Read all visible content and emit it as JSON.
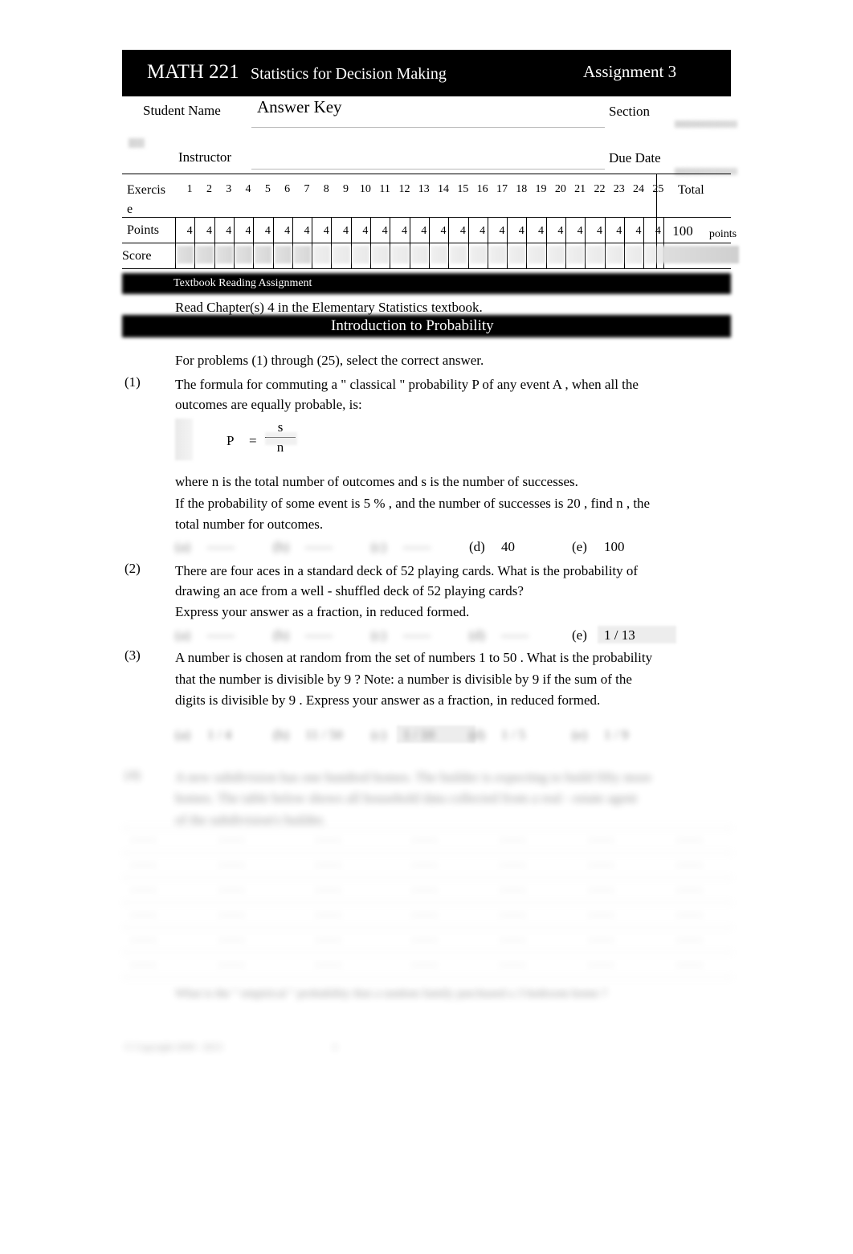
{
  "header": {
    "course": "MATH 221",
    "title": "Statistics for Decision Making",
    "assignment": "Assignment 3"
  },
  "info": {
    "student_name_label": "Student Name",
    "answer_key": "Answer Key",
    "section_label": "Section",
    "instructor_label": "Instructor",
    "due_date_label": "Due Date"
  },
  "grade_table": {
    "exercise_label": "Exercis",
    "exercise_label_2": "e",
    "points_label": "Points",
    "score_label": "Score",
    "total_label": "Total",
    "exercises": [
      "1",
      "2",
      "3",
      "4",
      "5",
      "6",
      "7",
      "8",
      "9",
      "10",
      "11",
      "12",
      "13",
      "14",
      "15",
      "16",
      "17",
      "18",
      "19",
      "20",
      "21",
      "22",
      "23",
      "24",
      "25"
    ],
    "points": [
      "4",
      "4",
      "4",
      "4",
      "4",
      "4",
      "4",
      "4",
      "4",
      "4",
      "4",
      "4",
      "4",
      "4",
      "4",
      "4",
      "4",
      "4",
      "4",
      "4",
      "4",
      "4",
      "4",
      "4",
      "4"
    ],
    "total_points": "100",
    "points_unit": "points"
  },
  "reading": {
    "bar_label": "Textbook Reading Assignment",
    "line": "Read Chapter(s) 4 in the Elementary Statistics",
    "line_tail": "textbook."
  },
  "section": {
    "title": "Introduction to Probability"
  },
  "instructions": {
    "line": "For problems   (1)  through   (25), select the correct answer."
  },
  "problems": [
    {
      "number": "(1)",
      "lines": [
        "The formula for commuting a \" classical \"  probability        P  of any event    A , when all the",
        "outcomes are equally probable, is:"
      ],
      "formula": {
        "p": "P",
        "eq": "=",
        "numerator": "s",
        "denominator": "n"
      },
      "after_lines": [
        "where   n   is the total number of outcomes and          s is the number of successes.",
        "If the probability of some event is 5      % , and the number of successes is 20 , find          n ,  the",
        "total number for outcomes."
      ],
      "choices": [
        {
          "key": "(a)",
          "value": "",
          "blurred": true
        },
        {
          "key": "(b)",
          "value": "",
          "blurred": true
        },
        {
          "key": "(c)",
          "value": "",
          "blurred": true
        },
        {
          "key": "(d)",
          "value": "40",
          "blurred": false
        },
        {
          "key": "(e)",
          "value": "100",
          "blurred": false
        }
      ]
    },
    {
      "number": "(2)",
      "lines": [
        "There are four aces in a standard deck of 52 playing cards.  What is the probability of",
        "drawing an ace from a well - shuffled deck of 52 playing cards?",
        "Express your answer as a fraction, in reduced formed."
      ],
      "choices": [
        {
          "key": "(a)",
          "value": "",
          "blurred": true
        },
        {
          "key": "(b)",
          "value": "",
          "blurred": true
        },
        {
          "key": "(c)",
          "value": "",
          "blurred": true
        },
        {
          "key": "(d)",
          "value": "",
          "blurred": true
        },
        {
          "key": "(e)",
          "value": "1 / 13",
          "blurred": false,
          "highlight": true
        }
      ]
    },
    {
      "number": "(3)",
      "lines": [
        "A number is chosen at random from the set of numbers 1 to 50 .  What is the probability",
        "that the number is divisible by 9 ?  Note:        a number is divisible by 9 if the sum of the",
        "digits is divisible by 9 .  Express your answer as a fraction, in reduced formed."
      ],
      "choices": [
        {
          "key": "(a)",
          "value": "1 / 4",
          "blurred": true
        },
        {
          "key": "(b)",
          "value": "11 / 50",
          "blurred": true
        },
        {
          "key": "(c)",
          "value": "1 / 10",
          "blurred": true,
          "highlight": true
        },
        {
          "key": "(d)",
          "value": "1 / 5",
          "blurred": true
        },
        {
          "key": "(e)",
          "value": "1 / 9",
          "blurred": true
        }
      ]
    },
    {
      "number": "(4)",
      "lines": [
        "A new subdivision has one hundred homes. The builder is expecting to build fifty more",
        "homes. The table below shows all household data collected from a real - estate agent",
        "of the subdivision's builder."
      ],
      "blurred": true
    }
  ],
  "bottom_table": {
    "caption": "What is the \" empirical \" probability that a random family purchased a 3 bedroom home ?",
    "rows": [
      [
        "",
        "",
        "",
        "",
        "",
        "",
        ""
      ],
      [
        "",
        "",
        "",
        "",
        "",
        "",
        ""
      ],
      [
        "",
        "",
        "",
        "",
        "",
        "",
        ""
      ],
      [
        "",
        "",
        "",
        "",
        "",
        "",
        ""
      ],
      [
        "",
        "",
        "",
        "",
        "",
        "",
        ""
      ],
      [
        "",
        "",
        "",
        "",
        "",
        "",
        ""
      ]
    ]
  },
  "footer": {
    "copyright": "© Copyright 2009 - 2013",
    "page": "1"
  }
}
